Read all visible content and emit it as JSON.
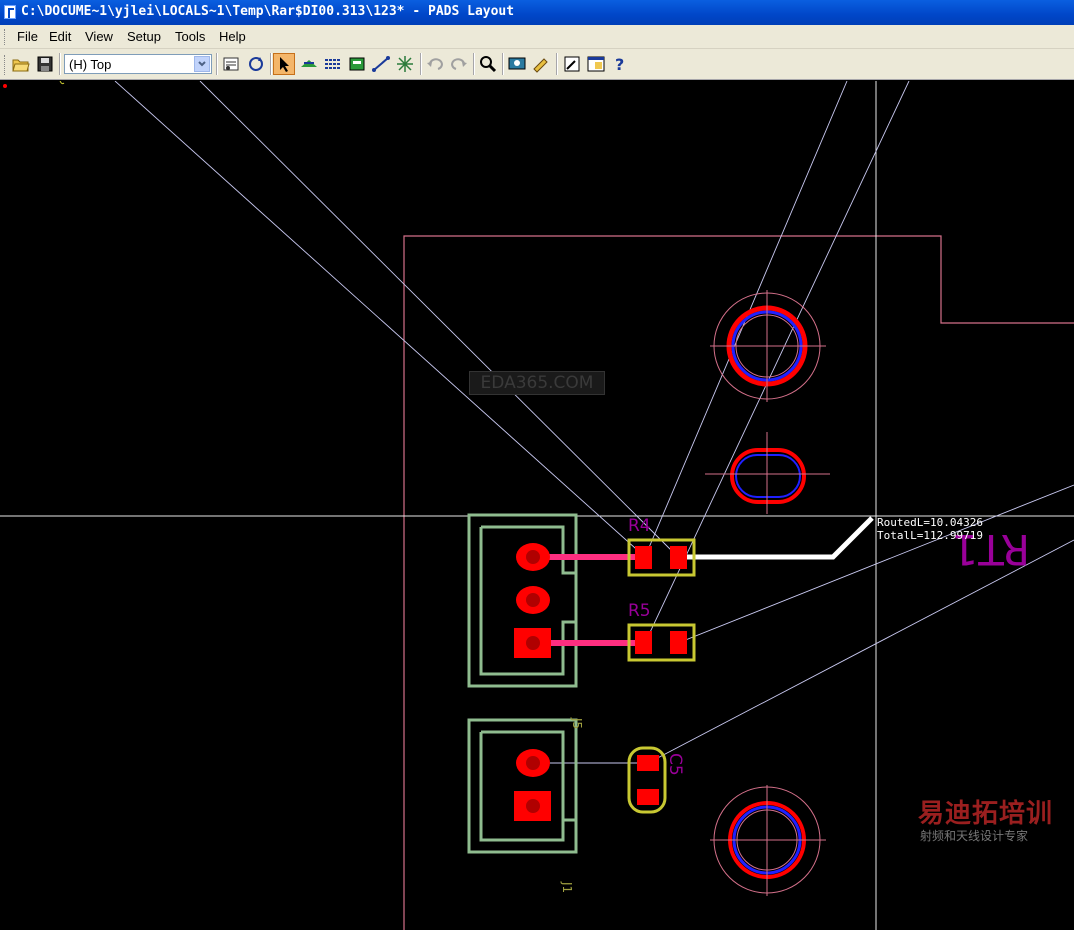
{
  "window": {
    "title": "C:\\DOCUME~1\\yjlei\\LOCALS~1\\Temp\\Rar$DI00.313\\123* - PADS Layout"
  },
  "menu": {
    "file": "File",
    "edit": "Edit",
    "view": "View",
    "setup": "Setup",
    "tools": "Tools",
    "help": "Help"
  },
  "toolbar": {
    "layer_value": "(H) Top",
    "icons": [
      "open-icon",
      "save-icon",
      "properties-icon",
      "redraw-icon",
      "select-icon",
      "drafting-toolbar-icon",
      "design-toolbar-icon",
      "ecogroup-icon",
      "route-icon",
      "cluster-icon",
      "undo-icon",
      "redo-icon",
      "zoom-icon",
      "verify-icon",
      "cam-icon",
      "sketch-icon",
      "window-icon",
      "help-icon"
    ]
  },
  "board": {
    "components": {
      "r4": "R4",
      "r5": "R5",
      "c5": "C5",
      "rt1": "RT1",
      "j_top": "J5",
      "j_bottom": "J1"
    },
    "readout": {
      "routed": "RoutedL=10.04326",
      "total": "TotalL=112.99719"
    },
    "watermark": "EDA365.COM",
    "logo_main": "易迪拓培训",
    "logo_sub": "射频和天线设计专家"
  },
  "colors": {
    "outline": "#d4708a",
    "pad": "#ff0000",
    "trace": "#ff2e80",
    "routed_trace": "#ffffff",
    "silk_header": "#8fbc8f",
    "silk_part": "#c8c832",
    "ref_label": "#990099",
    "ratsnest": "#c8c8f0"
  }
}
